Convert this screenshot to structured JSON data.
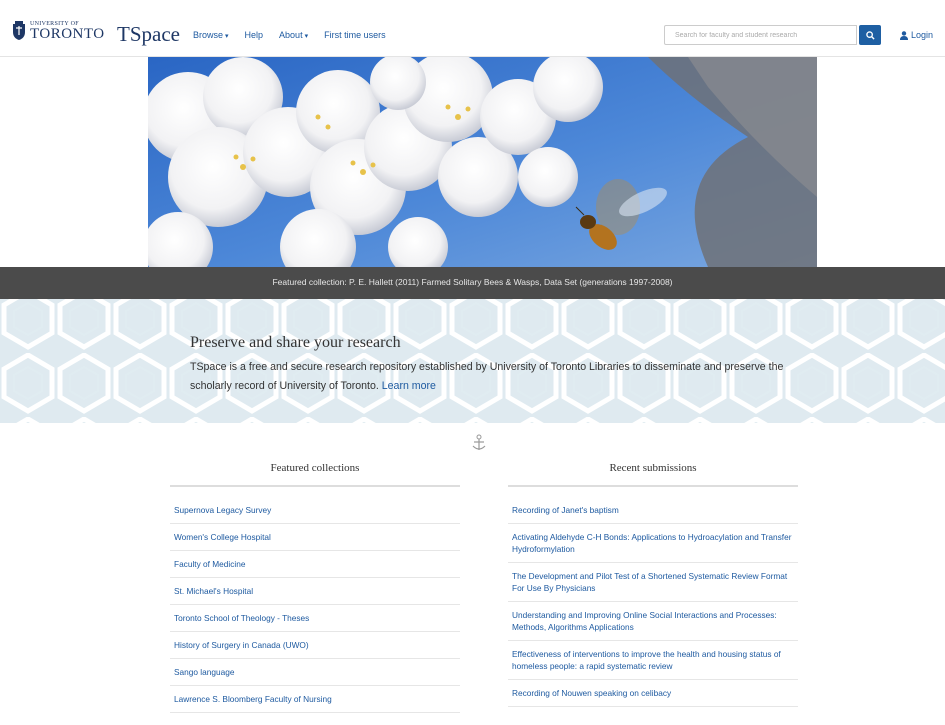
{
  "header": {
    "logo_small": "UNIVERSITY OF",
    "logo_big": "TORONTO",
    "brand": "TSpace",
    "nav": {
      "browse": "Browse",
      "help": "Help",
      "about": "About",
      "first_time": "First time users"
    },
    "search_placeholder": "Search for faculty and student research",
    "login": "Login"
  },
  "hero": {
    "caption": "Featured collection: P. E. Hallett (2011) Farmed Solitary Bees & Wasps, Data Set (generations 1997-2008)"
  },
  "intro": {
    "title": "Preserve and share your research",
    "text": "TSpace is a free and secure research repository established by University of Toronto Libraries to disseminate and preserve the scholarly record of University of Toronto.",
    "learn_more": "Learn more"
  },
  "featured": {
    "heading": "Featured collections",
    "items": [
      "Supernova Legacy Survey",
      "Women's College Hospital",
      "Faculty of Medicine",
      "St. Michael's Hospital",
      "Toronto School of Theology - Theses",
      "History of Surgery in Canada (UWO)",
      "Sango language",
      "Lawrence S. Bloomberg Faculty of Nursing"
    ]
  },
  "recent": {
    "heading": "Recent submissions",
    "items": [
      "Recording of Janet's baptism",
      "Activating Aldehyde C-H Bonds: Applications to Hydroacylation and Transfer Hydroformylation",
      "The Development and Pilot Test of a Shortened Systematic Review Format For Use By Physicians",
      "Understanding and Improving Online Social Interactions and Processes: Methods, Algorithms Applications",
      "Effectiveness of interventions to improve the health and housing status of homeless people: a rapid systematic review",
      "Recording of Nouwen speaking on celibacy"
    ]
  },
  "colors": {
    "brand_navy": "#1e3765",
    "link_blue": "#1e5aa0",
    "search_button": "#1e5fa3",
    "caption_bar": "#4b4b4b",
    "intro_band": "#eef5f8"
  },
  "icons": [
    "crest-icon",
    "search-icon",
    "user-icon",
    "caret-down-icon",
    "ornament-icon"
  ]
}
